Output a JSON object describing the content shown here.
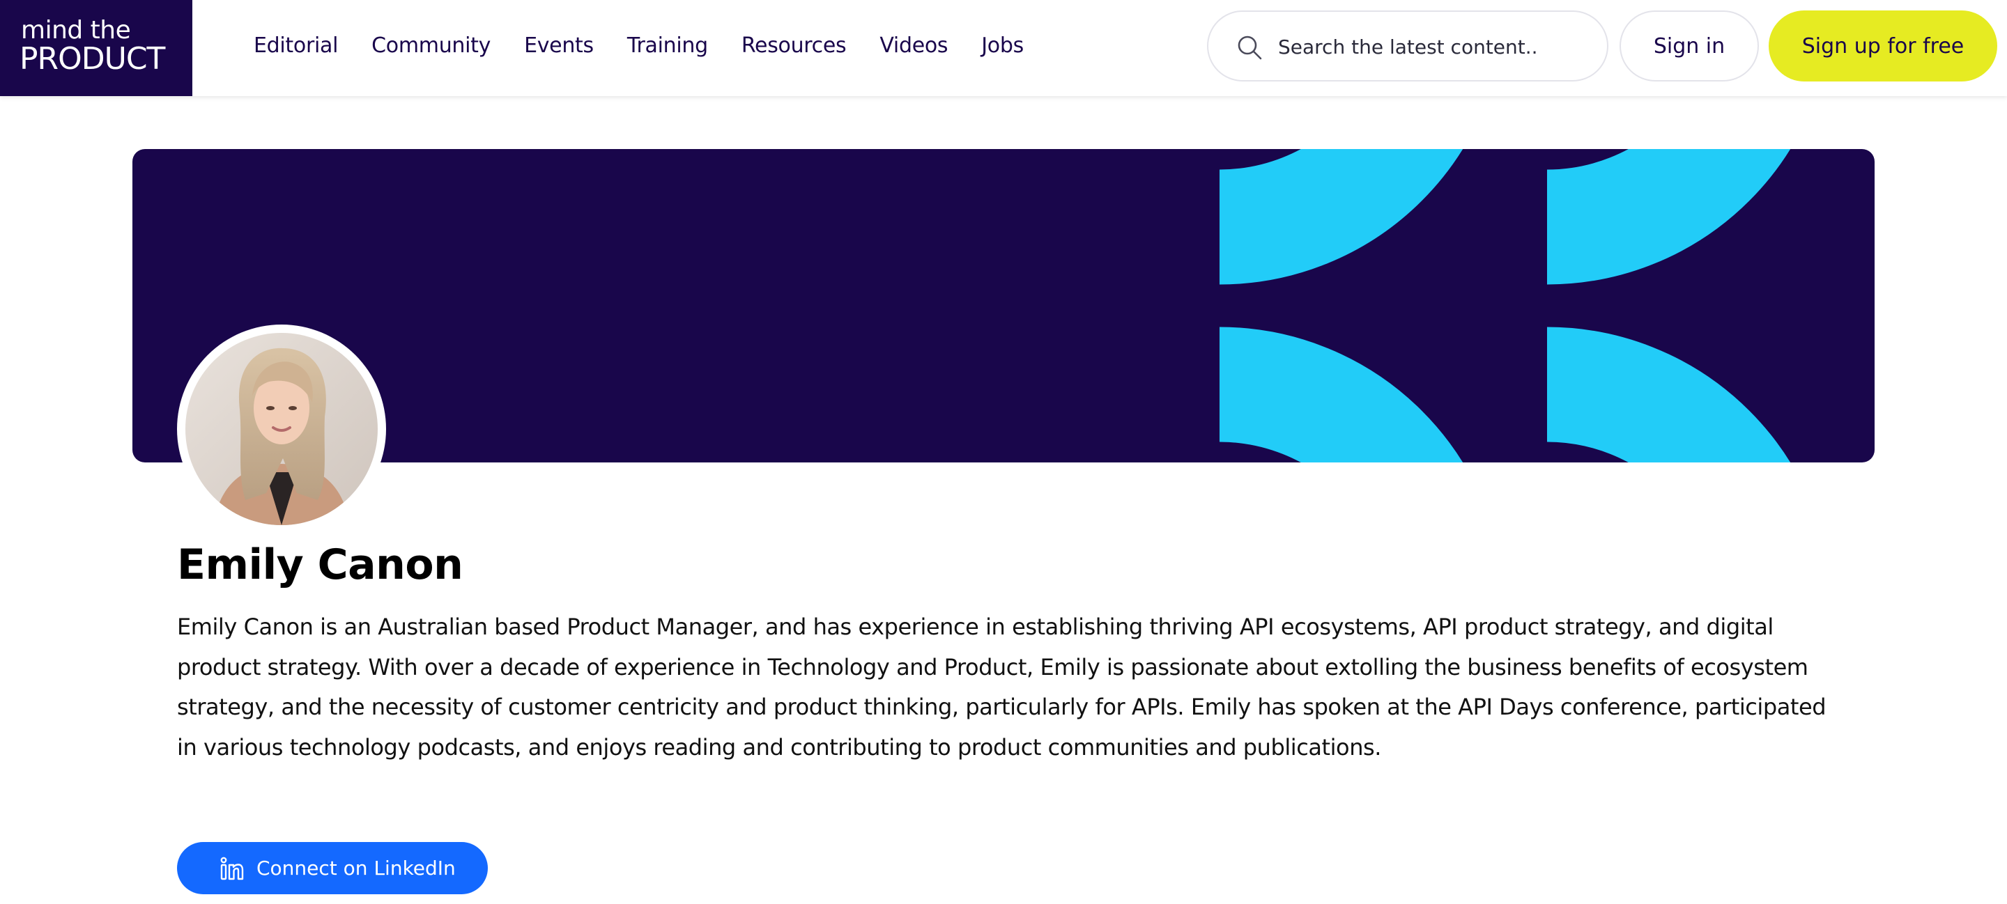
{
  "header": {
    "logo": {
      "line1": "mind the",
      "line2": "PRODUCT"
    },
    "nav": [
      {
        "label": "Editorial",
        "name": "nav-editorial"
      },
      {
        "label": "Community",
        "name": "nav-community"
      },
      {
        "label": "Events",
        "name": "nav-events"
      },
      {
        "label": "Training",
        "name": "nav-training"
      },
      {
        "label": "Resources",
        "name": "nav-resources"
      },
      {
        "label": "Videos",
        "name": "nav-videos"
      },
      {
        "label": "Jobs",
        "name": "nav-jobs"
      }
    ],
    "search": {
      "placeholder": "Search the latest content..",
      "value": "",
      "icon": "search-icon"
    },
    "signin_label": "Sign in",
    "signup_label": "Sign up for free"
  },
  "banner": {
    "background_color": "#19064b",
    "accent_color": "#22ccf8"
  },
  "profile": {
    "name": "Emily Canon",
    "bio": "Emily Canon is an Australian based Product Manager, and has experience in establishing thriving API ecosystems, API product strategy, and digital product strategy. With over a decade of experience in Technology and Product, Emily is passionate about extolling the business benefits of ecosystem strategy, and the necessity of customer centricity and product thinking, particularly for APIs. Emily has spoken at the API Days conference, participated in various technology podcasts, and enjoys reading and contributing to product communities and publications.",
    "avatar": "profile-photo",
    "linkedin": {
      "label": "Connect on LinkedIn",
      "icon": "linkedin-icon"
    }
  },
  "colors": {
    "brand_dark": "#19064b",
    "brand_yellow": "#e6eb22",
    "brand_cyan": "#22ccf8",
    "linkedin_blue": "#1469ff"
  }
}
